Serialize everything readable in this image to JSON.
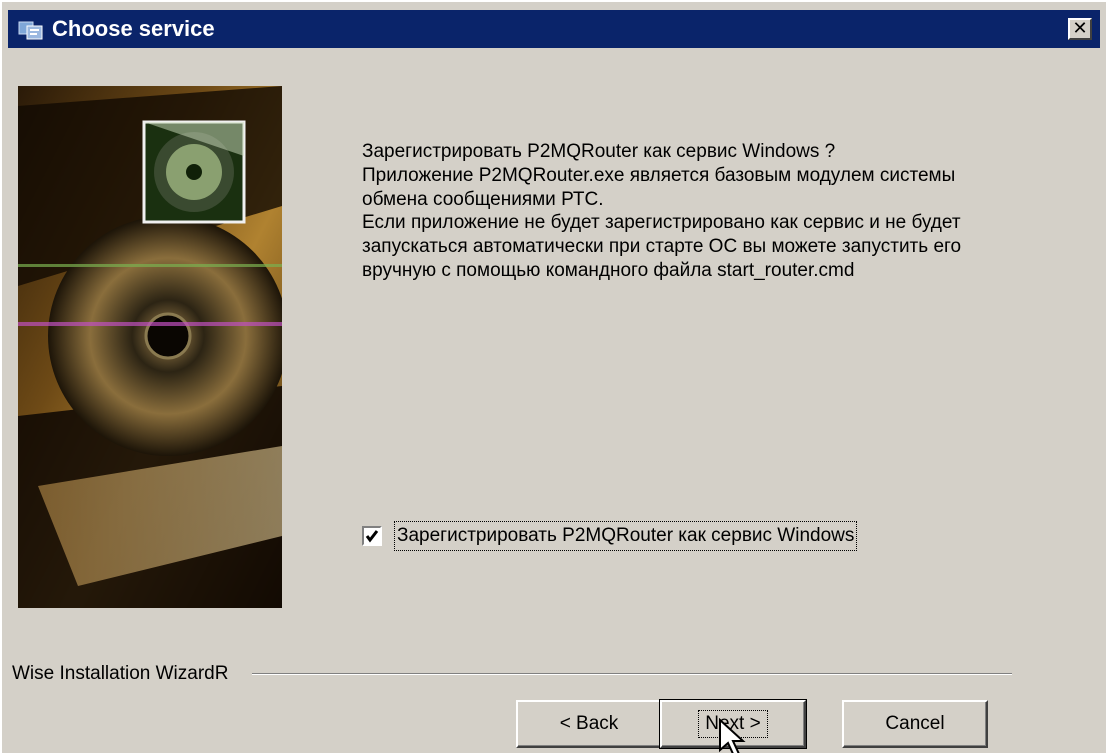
{
  "window": {
    "title": "Choose service",
    "close_symbol": "✕"
  },
  "description": {
    "paragraph1": "Зарегистрировать P2MQRouter как сервис Windows ?",
    "paragraph2": "Приложение P2MQRouter.exe является базовым модулем системы обмена сообщениями РТС.",
    "paragraph3": "Если приложение не будет зарегистрировано как сервис и не будет запускаться автоматически при старте ОС вы можете запустить его вручную с помощью командного файла start_router.cmd"
  },
  "checkbox": {
    "label": "Зарегистрировать P2MQRouter как сервис Windows",
    "checked": true
  },
  "footer": {
    "brand": "Wise Installation WizardR"
  },
  "buttons": {
    "back": "< Back",
    "next": "Next >",
    "cancel": "Cancel"
  },
  "colors": {
    "titlebar": "#0a246a",
    "dialog_bg": "#d4d0c8"
  },
  "icons": {
    "title": "installer-icon",
    "close": "close-icon",
    "check": "checkmark-icon",
    "cursor": "mouse-pointer-icon"
  }
}
